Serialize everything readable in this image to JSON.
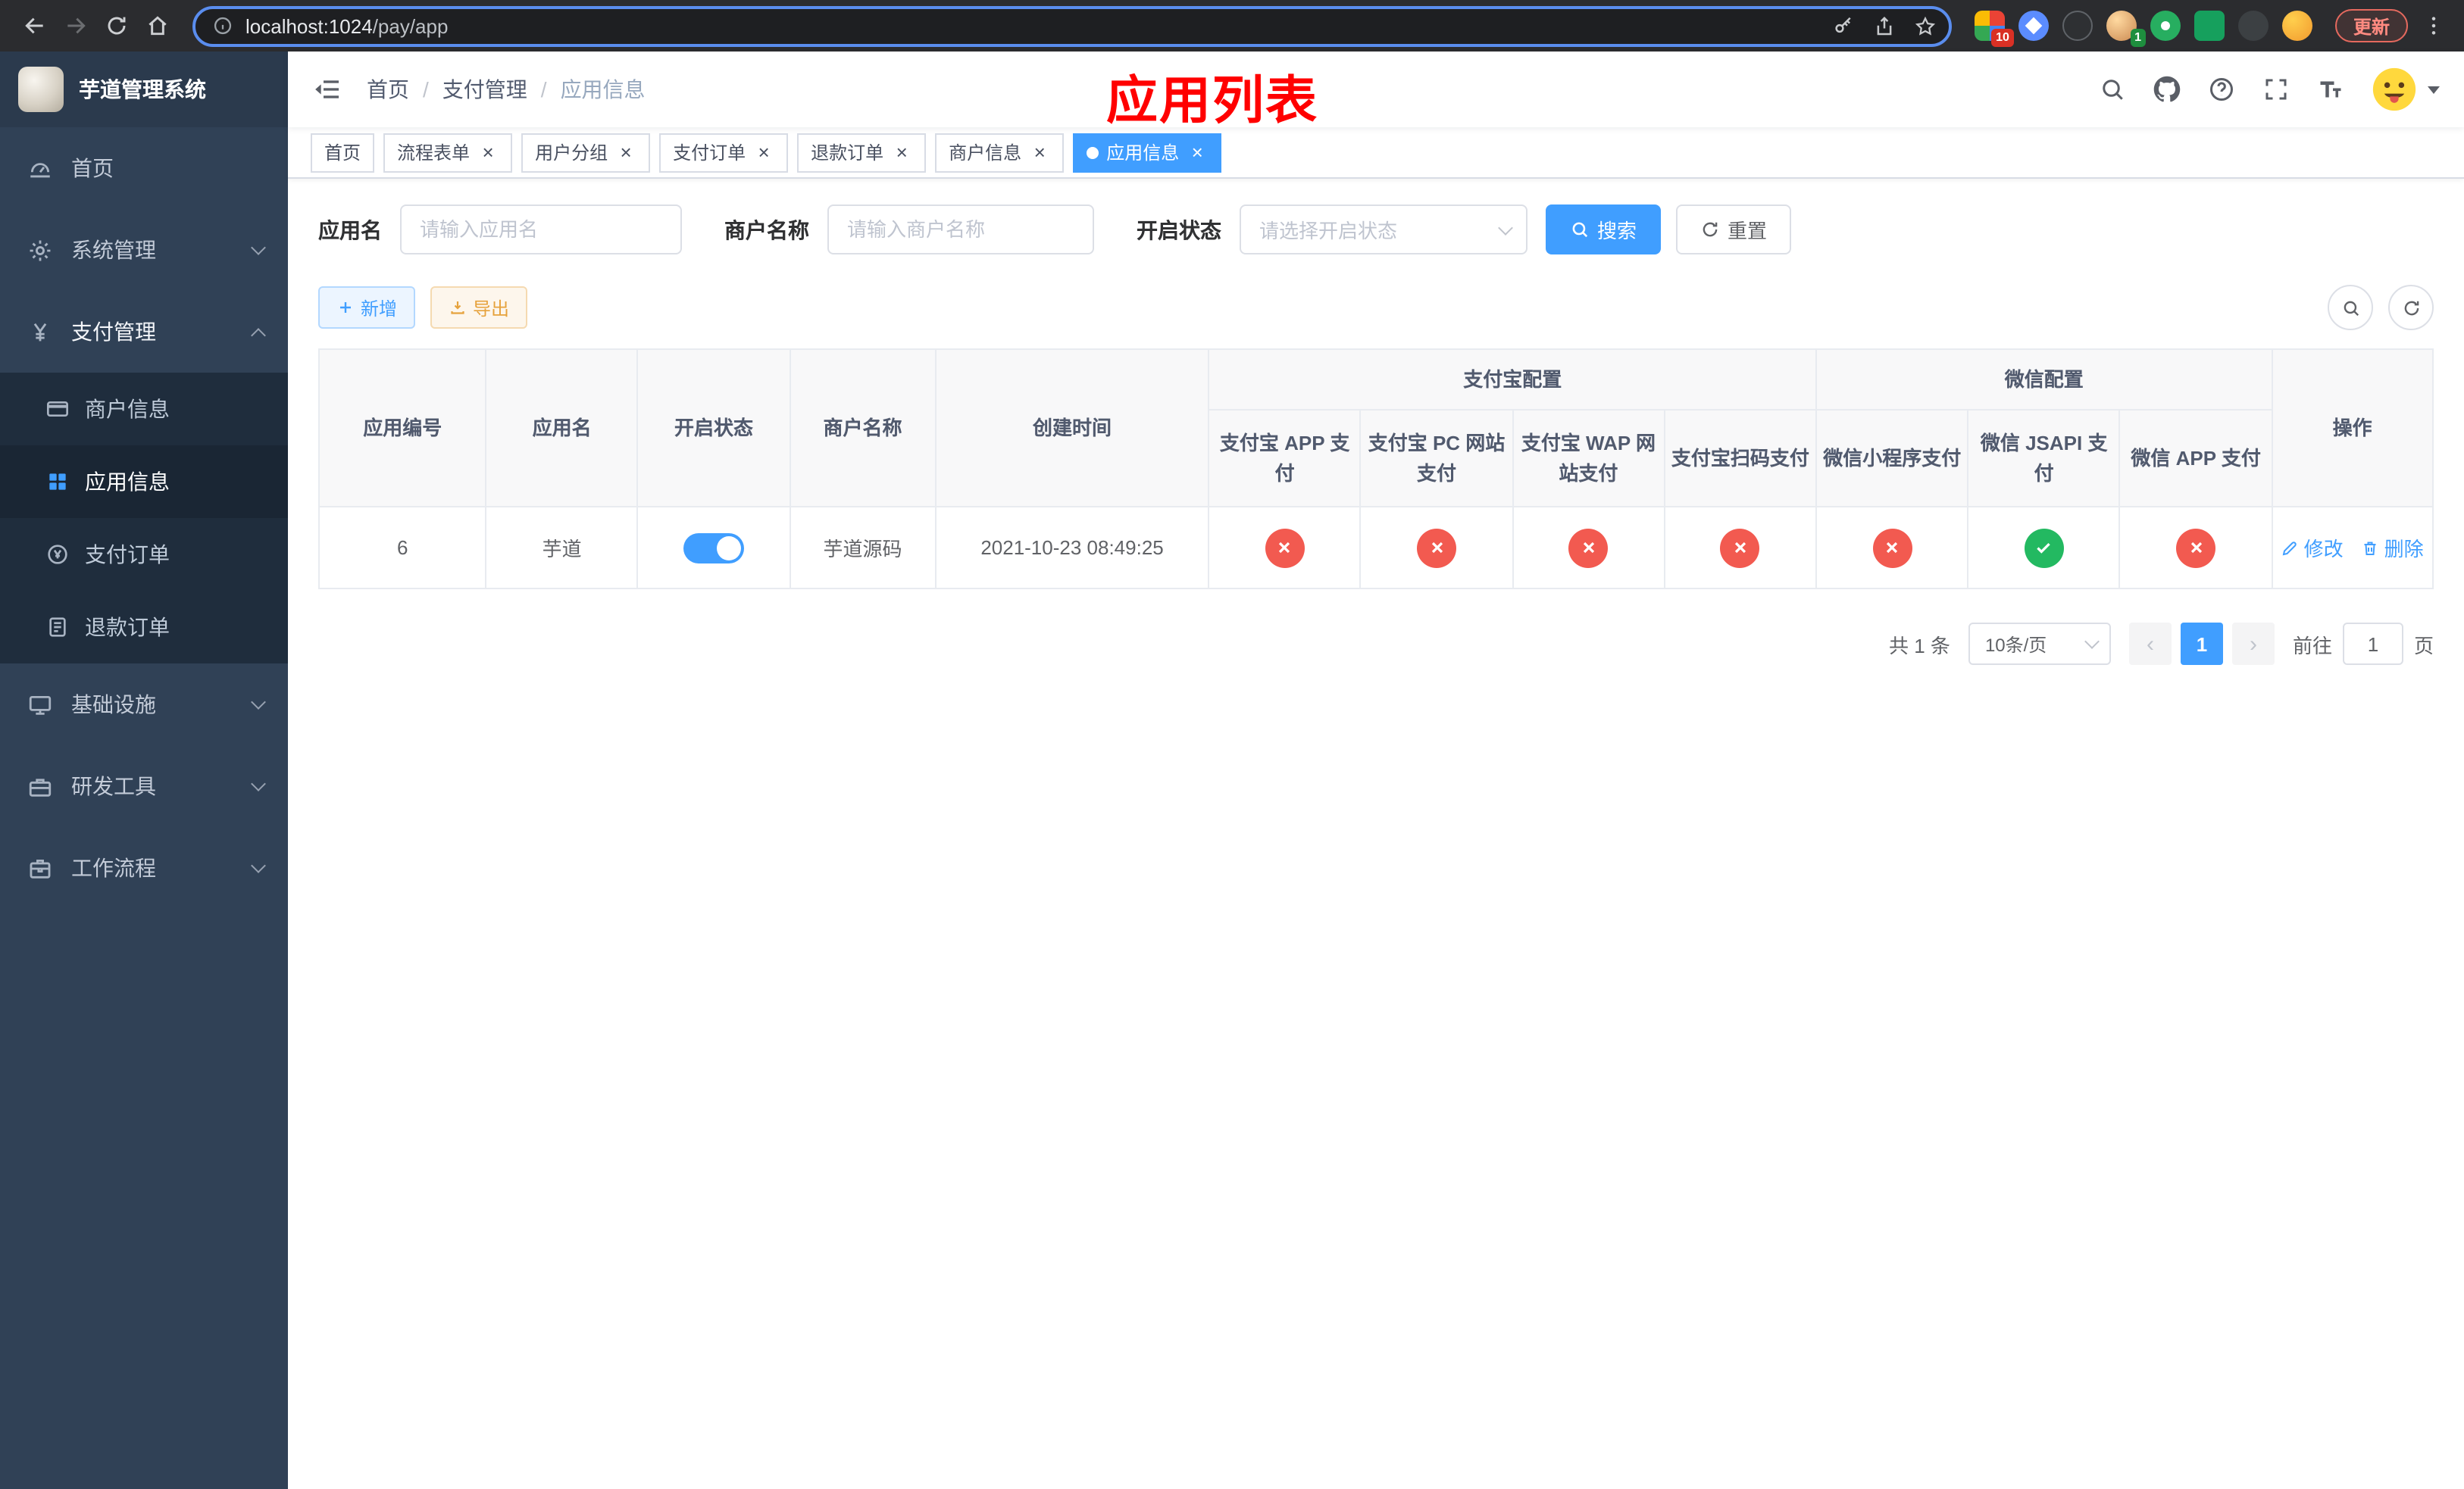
{
  "browser": {
    "url_host": "localhost:1024",
    "url_path": "/pay/app",
    "update_button": "更新",
    "extension_badge_count": "10",
    "profile_badge_count": "1"
  },
  "sidebar": {
    "logo_title": "芋道管理系统",
    "menu_home": "首页",
    "menu_system": "系统管理",
    "menu_payment": "支付管理",
    "sub_merchant_info": "商户信息",
    "sub_app_info": "应用信息",
    "sub_pay_order": "支付订单",
    "sub_refund_order": "退款订单",
    "menu_infra": "基础设施",
    "menu_devtools": "研发工具",
    "menu_workflow": "工作流程"
  },
  "header": {
    "breadcrumb_home": "首页",
    "breadcrumb_section": "支付管理",
    "breadcrumb_current": "应用信息",
    "banner": "应用列表"
  },
  "tabs": [
    {
      "label": "首页",
      "closable": false,
      "active": false
    },
    {
      "label": "流程表单",
      "closable": true,
      "active": false
    },
    {
      "label": "用户分组",
      "closable": true,
      "active": false
    },
    {
      "label": "支付订单",
      "closable": true,
      "active": false
    },
    {
      "label": "退款订单",
      "closable": true,
      "active": false
    },
    {
      "label": "商户信息",
      "closable": true,
      "active": false
    },
    {
      "label": "应用信息",
      "closable": true,
      "active": true
    }
  ],
  "filters": {
    "app_name_label": "应用名",
    "app_name_placeholder": "请输入应用名",
    "merchant_label": "商户名称",
    "merchant_placeholder": "请输入商户名称",
    "status_label": "开启状态",
    "status_placeholder": "请选择开启状态",
    "search_button": "搜索",
    "reset_button": "重置"
  },
  "toolbar": {
    "add_button": "新增",
    "export_button": "导出"
  },
  "table": {
    "group_alipay": "支付宝配置",
    "group_wechat": "微信配置",
    "col_app_id": "应用编号",
    "col_app_name": "应用名",
    "col_status": "开启状态",
    "col_merchant": "商户名称",
    "col_created": "创建时间",
    "col_alipay_app": "支付宝 APP 支付",
    "col_alipay_pc": "支付宝 PC 网站支付",
    "col_alipay_wap": "支付宝 WAP 网站支付",
    "col_alipay_qr": "支付宝扫码支付",
    "col_wx_mini": "微信小程序支付",
    "col_wx_jsapi": "微信 JSAPI 支付",
    "col_wx_app": "微信 APP 支付",
    "col_actions": "操作",
    "row": {
      "app_id": "6",
      "app_name": "芋道",
      "status": "on",
      "merchant": "芋道源码",
      "created": "2021-10-23 08:49:25",
      "configs": [
        "no",
        "no",
        "no",
        "no",
        "no",
        "yes",
        "no"
      ],
      "edit_label": "修改",
      "delete_label": "删除"
    }
  },
  "pagination": {
    "total": "共 1 条",
    "page_size": "10条/页",
    "page": "1",
    "goto_label": "前往",
    "goto_value": "1",
    "goto_unit": "页"
  },
  "colors": {
    "accent": "#409eff",
    "success": "#23b961",
    "danger": "#f25a50",
    "warning": "#e6a23c",
    "banner_red": "#ff0000",
    "sidebar_bg": "#304156",
    "submenu_bg": "#1f2d3d"
  }
}
